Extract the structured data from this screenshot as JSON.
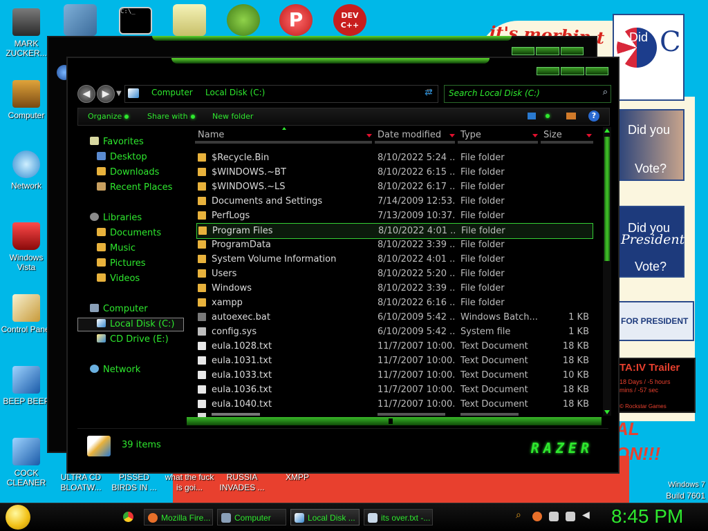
{
  "desktop": {
    "icons": [
      {
        "label": "MARK ZUCKER...",
        "icon": "person-icon"
      },
      {
        "label": "Computer",
        "icon": "computer-icon"
      },
      {
        "label": "Network",
        "icon": "network-globe-icon"
      },
      {
        "label": "Windows Vista",
        "icon": "recycle-bin-icon"
      },
      {
        "label": "Control Panel",
        "icon": "control-panel-icon"
      },
      {
        "label": "BEEP BEEP",
        "icon": "blue-file-icon"
      },
      {
        "label": "COCK CLEANER",
        "icon": "blue-file-icon"
      }
    ],
    "top_icons": [
      "generic-app-icon",
      "blue-app-icon",
      "cmd-icon",
      "stamp-app-icon",
      "pig-game-icon",
      "p-app-icon",
      "dev-cpp-icon"
    ],
    "dev_icon_text": "DEV C++",
    "bottom_labels": [
      "ULTRA CD BLOATW...",
      "PISSED BIRDS IN ...",
      "what the fuck is goi...",
      "RUSSIA INVADES ...",
      "XMPP"
    ],
    "watermark_line1": "Windows 7",
    "watermark_line2": "Build 7601"
  },
  "wallpaper": {
    "banner_text": "it's morbin t",
    "poster1_text": "Did",
    "poster2_line1": "Did you",
    "poster2_line2": "Vote?",
    "poster3_line1": "Did you",
    "poster3_line2": "President",
    "poster3_line3": "Vote?",
    "poster4_text": "FOR PRESIDENT",
    "poster5_title": "TA:IV Trailer",
    "poster5_line1": "18 Days / -5 hours",
    "poster5_line2": "mins / -57 sec",
    "poster5_footer": "© Rockstar Games",
    "red_text_1": "AL",
    "red_text_2": "ON!!!"
  },
  "explorer": {
    "breadcrumb": [
      "Computer",
      "Local Disk (C:)"
    ],
    "search_placeholder": "Search Local Disk (C:)",
    "toolbar": {
      "organize": "Organize",
      "share_with": "Share with",
      "new_folder": "New folder",
      "help": "?"
    },
    "nav": {
      "favorites": "Favorites",
      "favorites_items": [
        "Desktop",
        "Downloads",
        "Recent Places"
      ],
      "libraries": "Libraries",
      "libraries_items": [
        "Documents",
        "Music",
        "Pictures",
        "Videos"
      ],
      "computer": "Computer",
      "computer_items": [
        "Local Disk (C:)",
        "CD Drive (E:)"
      ],
      "network": "Network"
    },
    "columns": [
      "Name",
      "Date modified",
      "Type",
      "Size"
    ],
    "files": [
      {
        "name": "$Recycle.Bin",
        "date": "8/10/2022 5:24 ...",
        "type": "File folder",
        "size": "",
        "kind": "folder"
      },
      {
        "name": "$WINDOWS.~BT",
        "date": "8/10/2022 6:15 ...",
        "type": "File folder",
        "size": "",
        "kind": "folder"
      },
      {
        "name": "$WINDOWS.~LS",
        "date": "8/10/2022 6:17 ...",
        "type": "File folder",
        "size": "",
        "kind": "folder"
      },
      {
        "name": "Documents and Settings",
        "date": "7/14/2009 12:53...",
        "type": "File folder",
        "size": "",
        "kind": "folder"
      },
      {
        "name": "PerfLogs",
        "date": "7/13/2009 10:37...",
        "type": "File folder",
        "size": "",
        "kind": "folder"
      },
      {
        "name": "Program Files",
        "date": "8/10/2022 4:01 ...",
        "type": "File folder",
        "size": "",
        "kind": "folder"
      },
      {
        "name": "ProgramData",
        "date": "8/10/2022 3:39 ...",
        "type": "File folder",
        "size": "",
        "kind": "folder"
      },
      {
        "name": "System Volume Information",
        "date": "8/10/2022 4:01 ...",
        "type": "File folder",
        "size": "",
        "kind": "folder"
      },
      {
        "name": "Users",
        "date": "8/10/2022 5:20 ...",
        "type": "File folder",
        "size": "",
        "kind": "folder"
      },
      {
        "name": "Windows",
        "date": "8/10/2022 3:39 ...",
        "type": "File folder",
        "size": "",
        "kind": "folder"
      },
      {
        "name": "xampp",
        "date": "8/10/2022 6:16 ...",
        "type": "File folder",
        "size": "",
        "kind": "folder"
      },
      {
        "name": "autoexec.bat",
        "date": "6/10/2009 5:42 ...",
        "type": "Windows Batch...",
        "size": "1 KB",
        "kind": "batch"
      },
      {
        "name": "config.sys",
        "date": "6/10/2009 5:42 ...",
        "type": "System file",
        "size": "1 KB",
        "kind": "system"
      },
      {
        "name": "eula.1028.txt",
        "date": "11/7/2007 10:00...",
        "type": "Text Document",
        "size": "18 KB",
        "kind": "text"
      },
      {
        "name": "eula.1031.txt",
        "date": "11/7/2007 10:00...",
        "type": "Text Document",
        "size": "18 KB",
        "kind": "text"
      },
      {
        "name": "eula.1033.txt",
        "date": "11/7/2007 10:00...",
        "type": "Text Document",
        "size": "10 KB",
        "kind": "text"
      },
      {
        "name": "eula.1036.txt",
        "date": "11/7/2007 10:00...",
        "type": "Text Document",
        "size": "18 KB",
        "kind": "text"
      },
      {
        "name": "eula.1040.txt",
        "date": "11/7/2007 10:00...",
        "type": "Text Document",
        "size": "18 KB",
        "kind": "text"
      }
    ],
    "selected_index": 5,
    "item_count": "39 items",
    "brand": "RAZER"
  },
  "taskbar": {
    "tasks": [
      {
        "label": "Mozilla Fire...",
        "icon": "firefox-icon"
      },
      {
        "label": "Computer",
        "icon": "explorer-icon"
      },
      {
        "label": "Local Disk ...",
        "icon": "drive-icon"
      },
      {
        "label": "its over.txt -...",
        "icon": "notepad-icon"
      }
    ],
    "clock": "8:45 PM"
  },
  "colors": {
    "accent": "#2ee82e",
    "desktop": "#00b8e8",
    "wallpaper_red": "#e8402e",
    "folder": "#e8b23c"
  }
}
